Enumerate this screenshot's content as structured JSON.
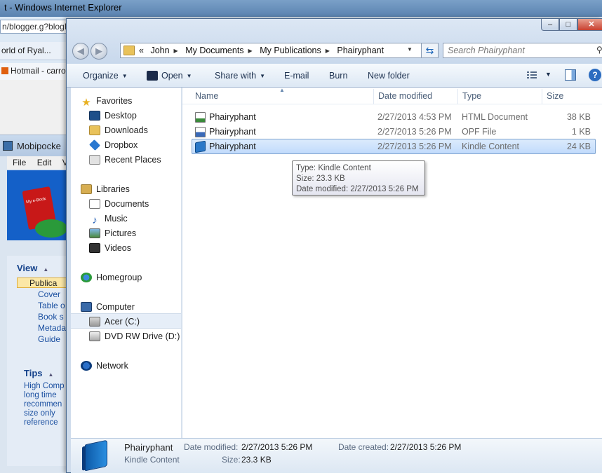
{
  "ie": {
    "title": "t - Windows Internet Explorer",
    "address_fragment": "n/blogger.g?blogI",
    "tab_fragment": "orld of Ryal...",
    "fav_fragment": "Hotmail - carro"
  },
  "mobipocket": {
    "title": "Mobipocke",
    "menu": [
      "File",
      "Edit",
      "V"
    ],
    "banner_text": "My e-Book",
    "view_heading": "View",
    "view_items": [
      "Publica",
      "Cover",
      "Table o",
      "Book s",
      "Metada",
      "Guide"
    ],
    "tips_heading": "Tips",
    "tips_lines": [
      "High Comp",
      "long time",
      "recommen",
      "size only",
      "reference"
    ]
  },
  "explorer": {
    "window_buttons": {
      "minimize": "–",
      "maximize": "□",
      "close": "✕"
    },
    "breadcrumb": [
      "«",
      "John",
      "My Documents",
      "My Publications",
      "Phairyphant"
    ],
    "search_placeholder": "Search Phairyphant",
    "toolbar": {
      "organize": "Organize",
      "open": "Open",
      "share_with": "Share with",
      "email": "E-mail",
      "burn": "Burn",
      "new_folder": "New folder"
    },
    "nav": {
      "favorites": "Favorites",
      "favorites_items": [
        "Desktop",
        "Downloads",
        "Dropbox",
        "Recent Places"
      ],
      "libraries": "Libraries",
      "libraries_items": [
        "Documents",
        "Music",
        "Pictures",
        "Videos"
      ],
      "homegroup": "Homegroup",
      "computer": "Computer",
      "computer_items": [
        "Acer (C:)",
        "DVD RW Drive (D:) S"
      ],
      "network": "Network"
    },
    "columns": [
      "Name",
      "Date modified",
      "Type",
      "Size"
    ],
    "files": [
      {
        "name": "Phairyphant",
        "date": "2/27/2013 4:53 PM",
        "type": "HTML Document",
        "size": "38 KB",
        "icon": "html-file-icon"
      },
      {
        "name": "Phairyphant",
        "date": "2/27/2013 5:26 PM",
        "type": "OPF File",
        "size": "1 KB",
        "icon": "opf-file-icon"
      },
      {
        "name": "Phairyphant",
        "date": "2/27/2013 5:26 PM",
        "type": "Kindle Content",
        "size": "24 KB",
        "icon": "kindle-file-icon",
        "selected": true
      }
    ],
    "tooltip": [
      "Type: Kindle Content",
      "Size: 23.3 KB",
      "Date modified: 2/27/2013 5:26 PM"
    ],
    "details": {
      "name": "Phairyphant",
      "type": "Kindle Content",
      "date_modified_label": "Date modified:",
      "date_modified": "2/27/2013 5:26 PM",
      "size_label": "Size:",
      "size": "23.3 KB",
      "date_created_label": "Date created:",
      "date_created": "2/27/2013 5:26 PM"
    }
  }
}
